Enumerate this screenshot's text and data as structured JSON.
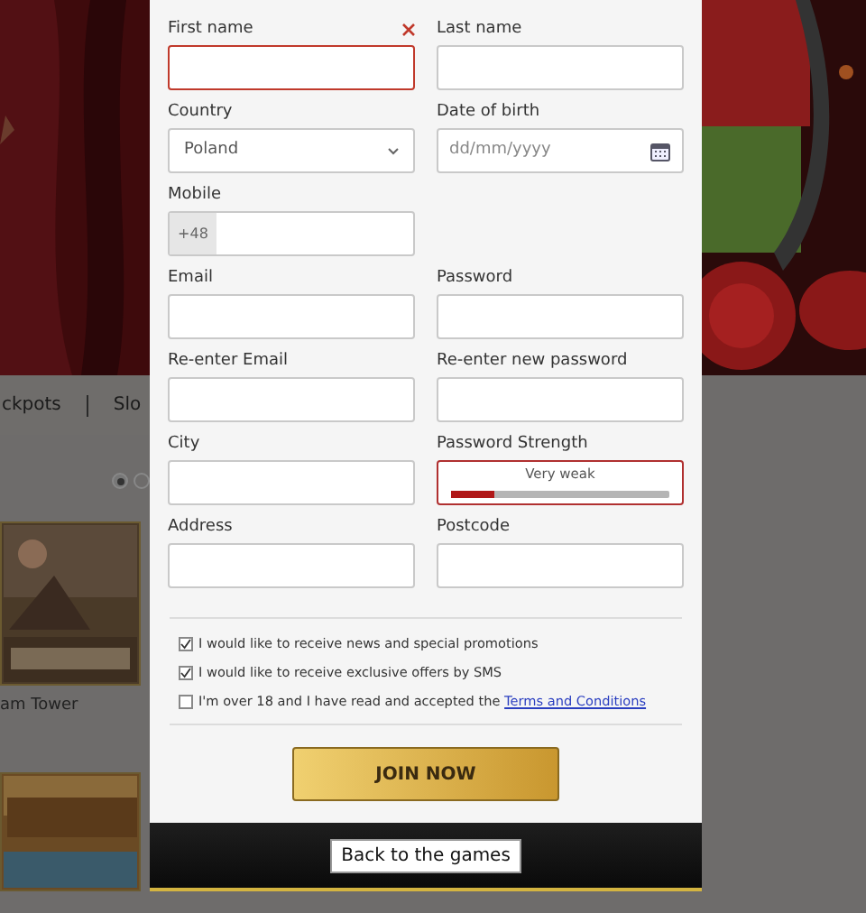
{
  "background": {
    "nav": {
      "items": [
        "ckpots",
        "Slo"
      ]
    },
    "carousel_dots": [
      {
        "selected": true
      },
      {
        "selected": false
      }
    ],
    "games": [
      {
        "title": "am Tower"
      }
    ]
  },
  "form": {
    "rows": [
      [
        {
          "kind": "text",
          "label": "First name",
          "error": true
        },
        {
          "kind": "text",
          "label": "Last name",
          "error": false
        }
      ],
      [
        {
          "kind": "select",
          "label": "Country",
          "value": "Poland",
          "error": false
        },
        {
          "kind": "date",
          "label": "Date of birth",
          "placeholder": "dd/mm/yyyy",
          "error": false
        }
      ],
      [
        {
          "kind": "phone",
          "label": "Mobile",
          "prefix": "+48",
          "error": false
        }
      ],
      [
        {
          "kind": "text",
          "label": "Email",
          "error": false
        },
        {
          "kind": "text",
          "label": "Password",
          "error": false
        }
      ],
      [
        {
          "kind": "text",
          "label": "Re-enter Email",
          "error": false
        },
        {
          "kind": "text",
          "label": "Re-enter new password",
          "error": false
        }
      ],
      [
        {
          "kind": "text",
          "label": "City",
          "error": false
        },
        {
          "kind": "strength",
          "label": "Password Strength",
          "reading": "Very weak",
          "level": 0.2
        }
      ],
      [
        {
          "kind": "text",
          "label": "Address",
          "error": false
        },
        {
          "kind": "text",
          "label": "Postcode",
          "error": false
        }
      ]
    ],
    "checkboxes": [
      {
        "text": "I would like to receive news and special promotions",
        "checked": true
      },
      {
        "text": "I would like to receive exclusive offers by SMS",
        "checked": true
      },
      {
        "text": "I'm over 18 and I have read and accepted the",
        "link": "Terms and Conditions",
        "checked": false
      }
    ],
    "submit": "JOIN NOW",
    "back": "Back to the games"
  }
}
